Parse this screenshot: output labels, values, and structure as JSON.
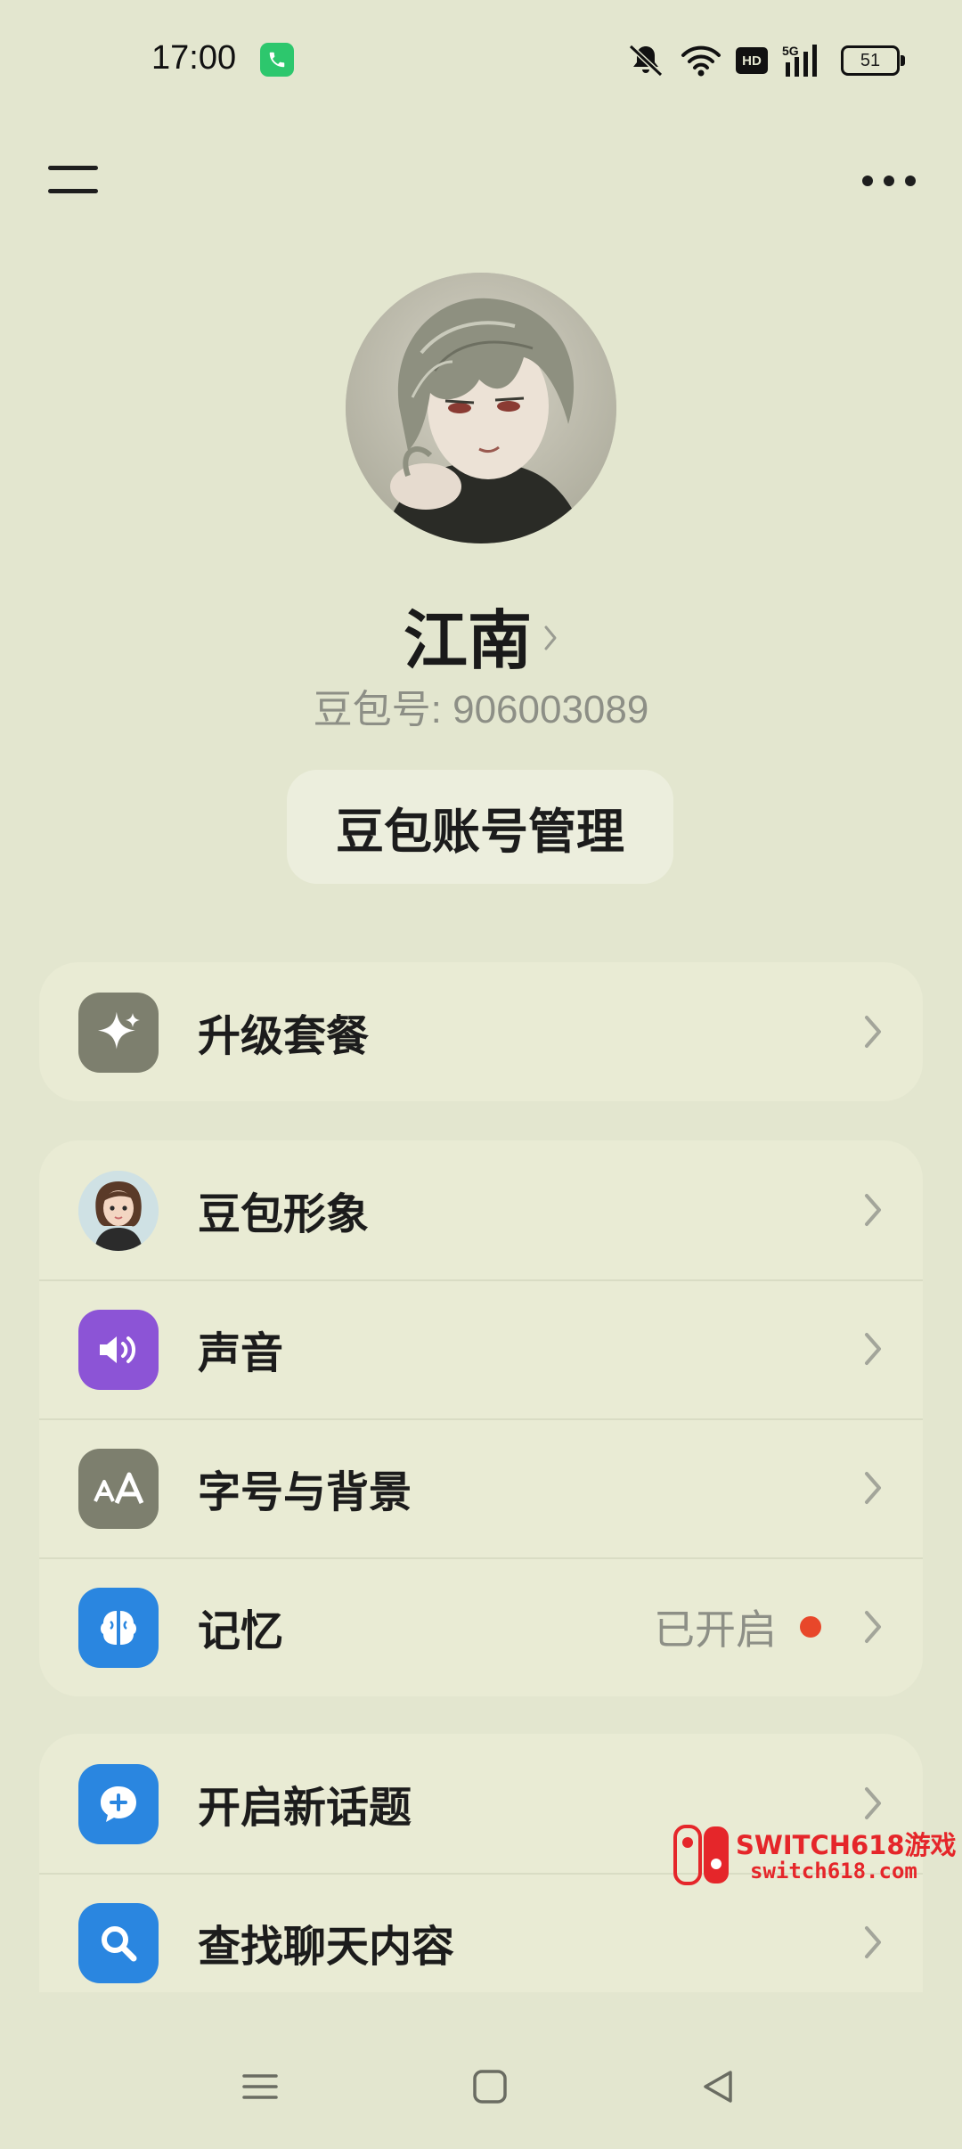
{
  "status_bar": {
    "time": "17:00",
    "network": "5G",
    "hd": "HD",
    "battery": "51"
  },
  "profile": {
    "name": "江南",
    "id_text": "豆包号: 906003089",
    "account_button": "豆包账号管理"
  },
  "sections": {
    "upgrade": {
      "label": "升级套餐",
      "icon": "sparkle-icon"
    },
    "settings": [
      {
        "label": "豆包形象",
        "icon": "persona-avatar-icon"
      },
      {
        "label": "声音",
        "icon": "speaker-icon"
      },
      {
        "label": "字号与背景",
        "icon": "font-size-icon"
      },
      {
        "label": "记忆",
        "icon": "brain-icon",
        "status": "已开启"
      }
    ],
    "chat": [
      {
        "label": "开启新话题",
        "icon": "new-chat-icon"
      },
      {
        "label": "查找聊天内容",
        "icon": "search-icon"
      }
    ]
  },
  "watermark": {
    "title": "SWITCH618游戏",
    "url": "switch618.com"
  },
  "colors": {
    "background": "#e3e6cf",
    "card": "#e9ebd4",
    "upgrade_icon": "#7d7f6e",
    "speaker_icon": "#8c54d6",
    "font_icon": "#7d7f6e",
    "brain_icon": "#2a86e0",
    "chat_icon": "#2a86e0",
    "status_dot": "#e8472a"
  }
}
